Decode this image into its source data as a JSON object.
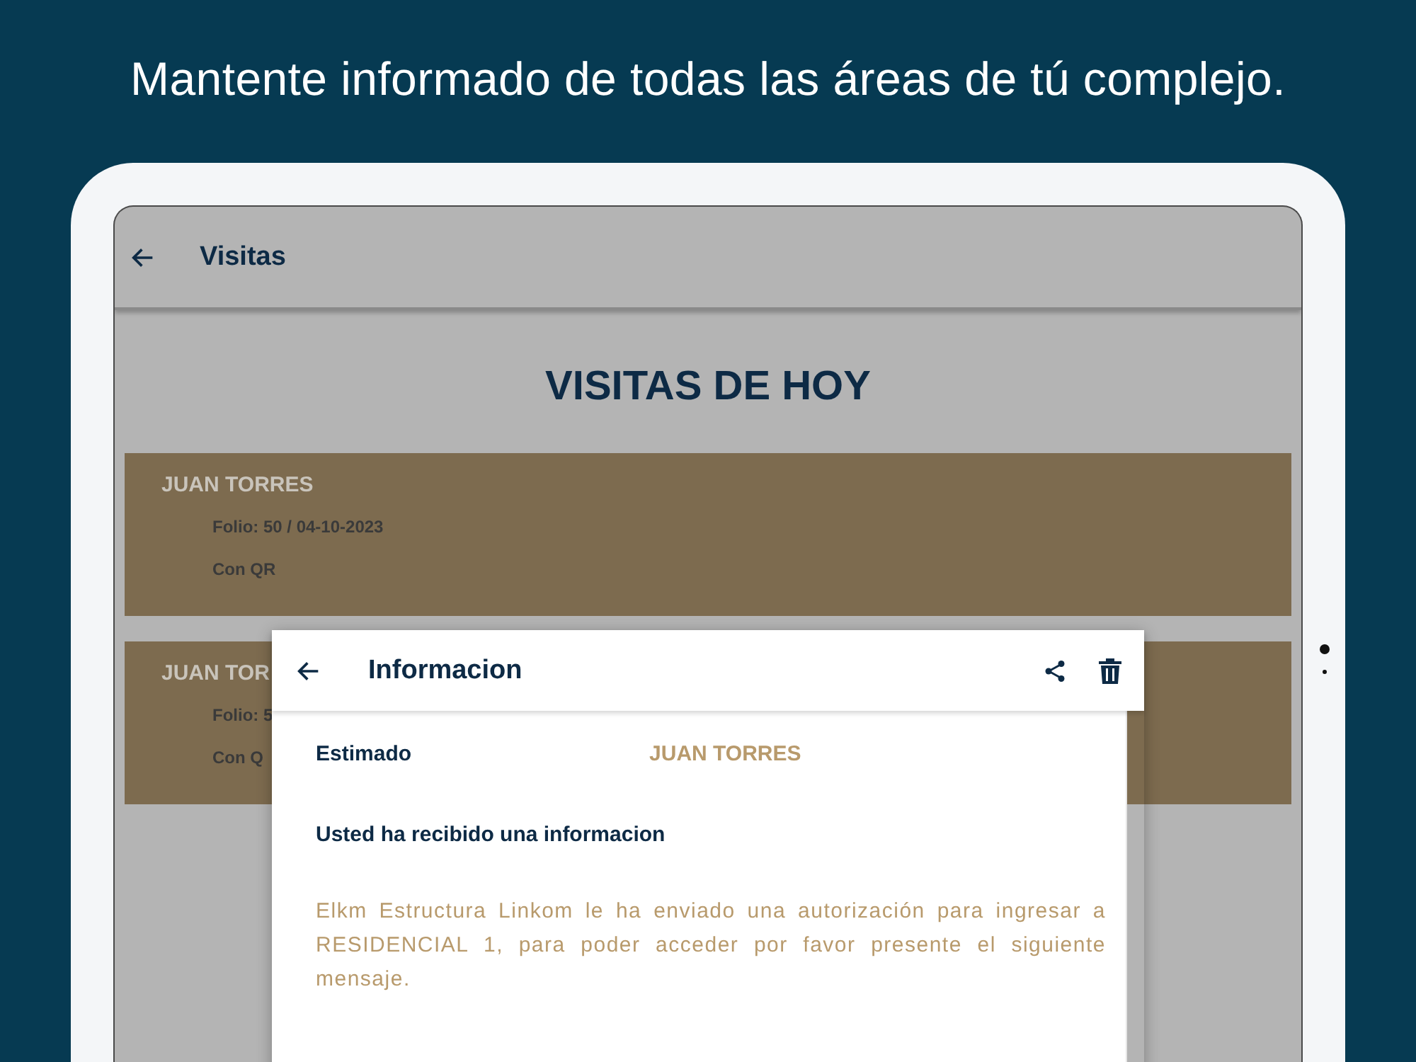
{
  "headline": "Mantente informado de todas las áreas de tú complejo.",
  "app_bar": {
    "title": "Visitas"
  },
  "section_title": "VISITAS DE HOY",
  "visits": [
    {
      "name": "JUAN TORRES",
      "folio": "Folio: 50 / 04-10-2023",
      "mode": "Con QR"
    },
    {
      "name": "JUAN TOR",
      "folio": "Folio: 5",
      "mode": "Con Q"
    }
  ],
  "dialog": {
    "title": "Informacion",
    "greeting_label": "Estimado",
    "recipient": "JUAN TORRES",
    "subtitle": "Usted ha recibido una informacion",
    "message": "Elkm Estructura Linkom le ha enviado una autorización para ingresar a RESIDENCIAL 1, para poder acceder por favor presente el siguiente mensaje."
  }
}
